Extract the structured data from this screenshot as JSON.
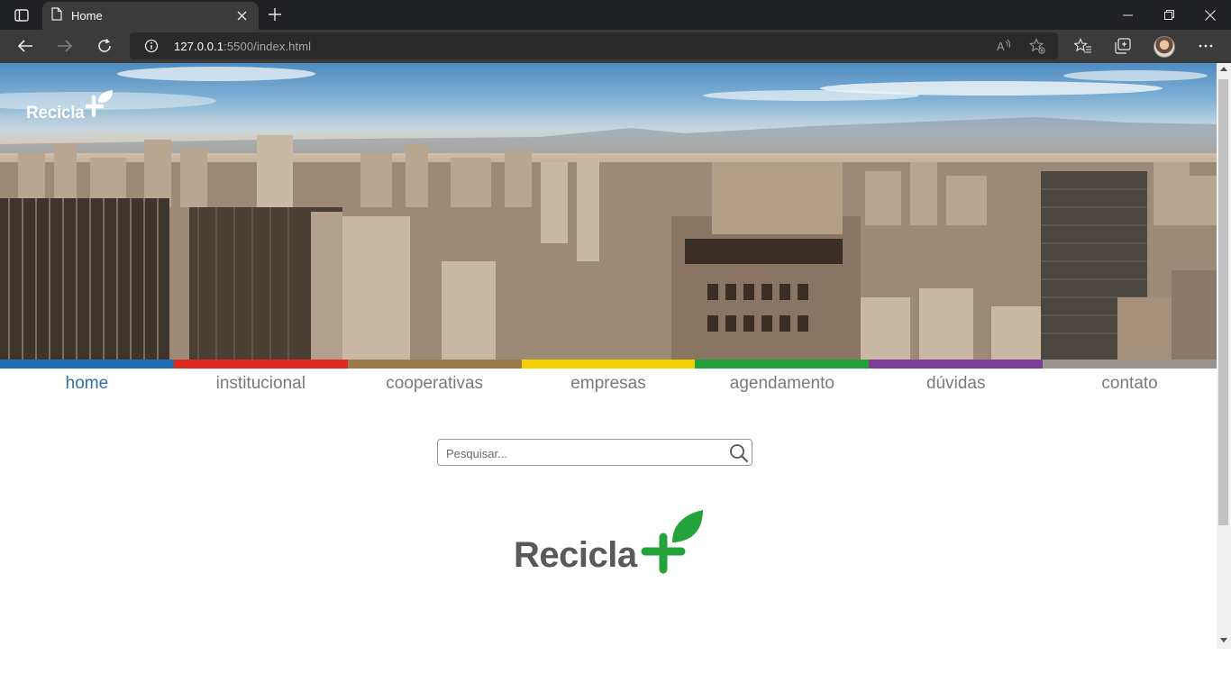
{
  "browser": {
    "tab_title": "Home",
    "url_host": "127.0.0.1",
    "url_rest": ":5500/index.html"
  },
  "site": {
    "brand": "Recicla",
    "nav": [
      {
        "label": "home",
        "color": "#1f6db3"
      },
      {
        "label": "institucional",
        "color": "#e02a1f"
      },
      {
        "label": "cooperativas",
        "color": "#9a7a4e"
      },
      {
        "label": "empresas",
        "color": "#f4d000"
      },
      {
        "label": "agendamento",
        "color": "#22a13a"
      },
      {
        "label": "dúvidas",
        "color": "#7a3e98"
      },
      {
        "label": "contato",
        "color": "#9a948e"
      }
    ],
    "search": {
      "placeholder": "Pesquisar..."
    },
    "colors": {
      "brand_green": "#24a23b",
      "brand_gray": "#595959",
      "nav_active": "#2e6fa8",
      "nav_text": "#7a7a7a"
    }
  }
}
